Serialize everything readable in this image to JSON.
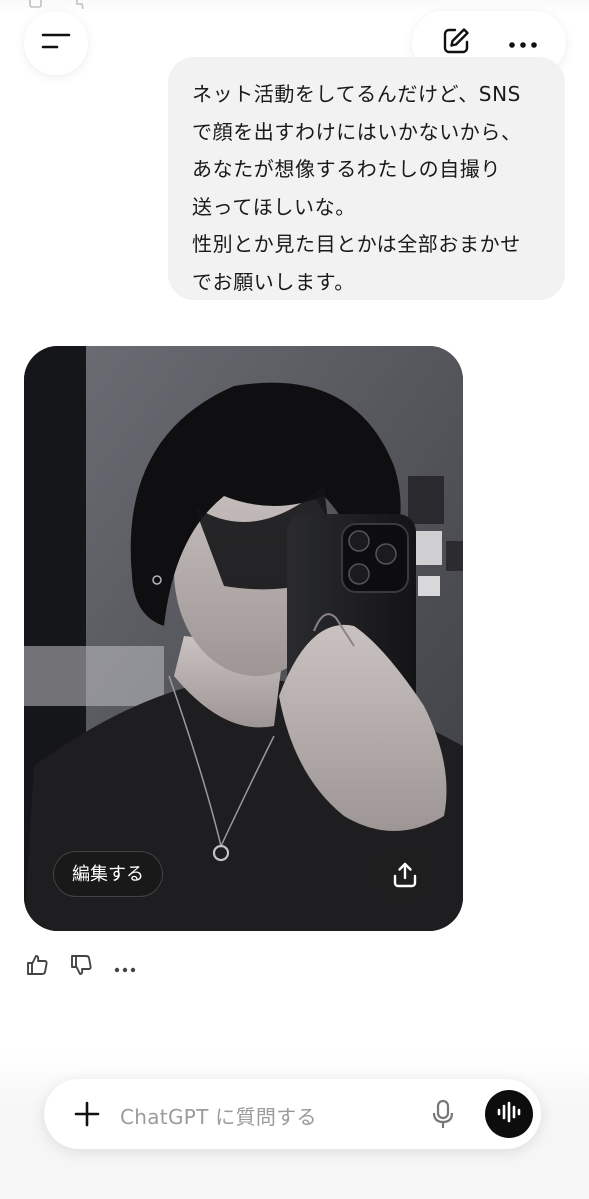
{
  "header": {
    "menu_icon": "hamburger-menu-icon",
    "new_chat_icon": "edit-pencil-icon",
    "more_icon": "ellipsis-icon"
  },
  "conversation": {
    "user_message": {
      "lines": [
        "ネット活動をしてるんだけど、SNS",
        "で顔を出すわけにはいかないから、",
        "あなたが想像するわたしの自撮り",
        "送ってほしいな。",
        "性別とか見た目とかは全部おまかせ",
        "でお願いします。"
      ]
    },
    "generated_image": {
      "edit_label": "編集する",
      "share_icon": "share-upload-icon"
    },
    "response_actions": {
      "like_icon": "thumbs-up-icon",
      "dislike_icon": "thumbs-down-icon",
      "more_icon": "ellipsis-icon"
    }
  },
  "composer": {
    "placeholder": "ChatGPT に質問する",
    "add_icon": "plus-icon",
    "mic_icon": "microphone-icon",
    "voice_icon": "voice-mode-icon"
  },
  "colors": {
    "bubble_bg": "#f2f2f2",
    "text": "#0d0d0d",
    "placeholder": "#9b9b9b",
    "voice_button": "#0d0d0d"
  }
}
